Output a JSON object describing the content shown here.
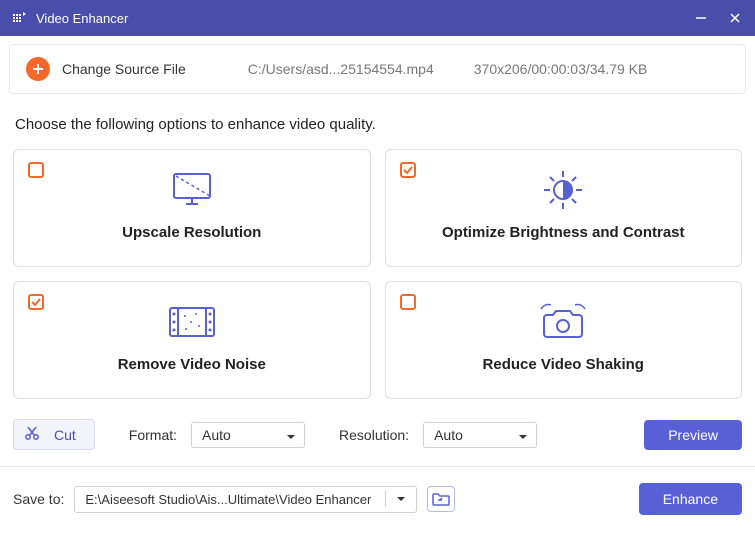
{
  "app": {
    "title": "Video Enhancer"
  },
  "source": {
    "button_label": "Change Source File",
    "file_path": "C:/Users/asd...25154554.mp4",
    "file_info": "370x206/00:00:03/34.79 KB"
  },
  "instruction": "Choose the following options to enhance video quality.",
  "options": {
    "upscale": {
      "title": "Upscale Resolution",
      "checked": false
    },
    "brightness": {
      "title": "Optimize Brightness and Contrast",
      "checked": true
    },
    "noise": {
      "title": "Remove Video Noise",
      "checked": true
    },
    "shaking": {
      "title": "Reduce Video Shaking",
      "checked": false
    }
  },
  "toolbar": {
    "cut_label": "Cut",
    "format_label": "Format:",
    "format_value": "Auto",
    "resolution_label": "Resolution:",
    "resolution_value": "Auto",
    "preview_label": "Preview"
  },
  "bottom": {
    "save_label": "Save to:",
    "save_path": "E:\\Aiseesoft Studio\\Ais...Ultimate\\Video Enhancer",
    "enhance_label": "Enhance"
  },
  "colors": {
    "accent": "#5860d6",
    "check": "#f5682a"
  }
}
